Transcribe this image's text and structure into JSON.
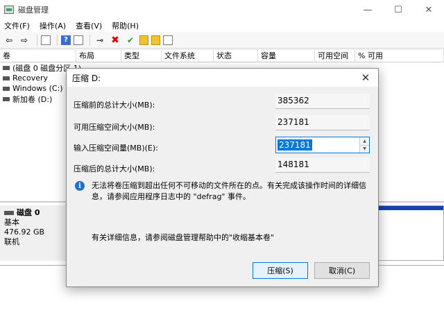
{
  "window": {
    "title": "磁盘管理",
    "controls": {
      "minimize": "—",
      "maximize": "☐",
      "close": "✕"
    }
  },
  "menu": [
    "文件(F)",
    "操作(A)",
    "查看(V)",
    "帮助(H)"
  ],
  "toolbar": {
    "icons": [
      "back-arrow-icon",
      "forward-arrow-icon",
      "properties-icon",
      "help-icon",
      "list-view-icon",
      "connect-icon",
      "delete-icon",
      "check-icon",
      "upload-icon",
      "open-folder-icon",
      "settings-icon"
    ]
  },
  "volume_table": {
    "columns": [
      "卷",
      "布局",
      "类型",
      "文件系统",
      "状态",
      "容量",
      "可用空间",
      "% 可用"
    ],
    "rows": [
      {
        "name": "(磁盘 0 磁盘分区 1)",
        "layout": "",
        "type": "",
        "fs": "",
        "status": "",
        "capacity": "",
        "free": "",
        "pct": ""
      },
      {
        "name": "Recovery"
      },
      {
        "name": "Windows (C:)"
      },
      {
        "name": "新加卷 (D:)"
      }
    ]
  },
  "disk": {
    "name": "磁盘 0",
    "type": "基本",
    "size": "476.92 GB",
    "status": "联机"
  },
  "dialog": {
    "title": "压缩 D:",
    "fields": [
      {
        "label": "压缩前的总计大小(MB):",
        "value": "385362"
      },
      {
        "label": "可用压缩空间大小(MB):",
        "value": "237181"
      },
      {
        "label": "输入压缩空间量(MB)(E):",
        "value": "237181"
      },
      {
        "label": "压缩后的总计大小(MB):",
        "value": "148181"
      }
    ],
    "info": "无法将卷压缩到超出任何不可移动的文件所在的点。有关完成该操作时间的详细信息，请参阅应用程序日志中的 \"defrag\" 事件。",
    "more": "有关详细信息，请参阅磁盘管理帮助中的\"收缩基本卷\"",
    "shrink_button": "压缩(S)",
    "cancel_button": "取消(C)"
  }
}
